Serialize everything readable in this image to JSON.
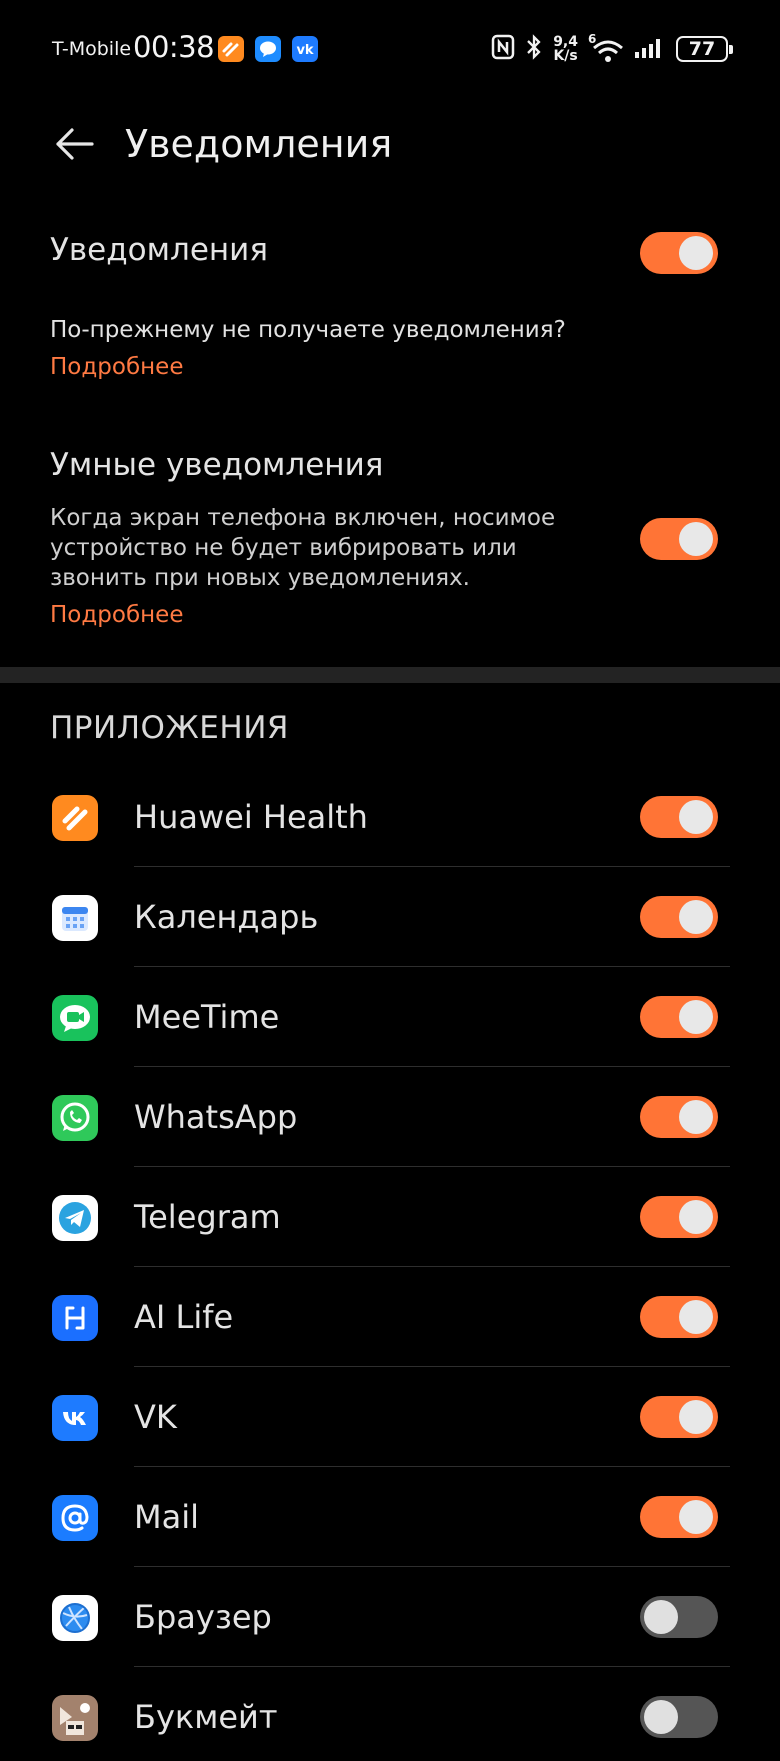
{
  "status_bar": {
    "carrier": "T-Mobile",
    "time": "00:38",
    "net_speed_value": "9,4",
    "net_speed_unit": "K/s",
    "wifi_label": "6",
    "battery": "77"
  },
  "header": {
    "title": "Уведомления"
  },
  "notifications": {
    "label": "Уведомления",
    "enabled": true,
    "hint": "По-прежнему не получаете уведомления?",
    "link": "Подробнее"
  },
  "smart": {
    "label": "Умные уведомления",
    "description": "Когда экран телефона включен, носимое устройство не будет вибрировать или звонить при новых уведомлениях.",
    "link": "Подробнее",
    "enabled": true
  },
  "apps_section": {
    "title": "ПРИЛОЖЕНИЯ",
    "items": [
      {
        "name": "Huawei Health",
        "icon": "huawei-health-icon",
        "enabled": true
      },
      {
        "name": "Календарь",
        "icon": "calendar-icon",
        "enabled": true
      },
      {
        "name": "MeeTime",
        "icon": "meetime-icon",
        "enabled": true
      },
      {
        "name": "WhatsApp",
        "icon": "whatsapp-icon",
        "enabled": true
      },
      {
        "name": "Telegram",
        "icon": "telegram-icon",
        "enabled": true
      },
      {
        "name": "AI Life",
        "icon": "ai-life-icon",
        "enabled": true
      },
      {
        "name": "VK",
        "icon": "vk-icon",
        "enabled": true
      },
      {
        "name": "Mail",
        "icon": "mail-icon",
        "enabled": true
      },
      {
        "name": "Браузер",
        "icon": "browser-icon",
        "enabled": false
      },
      {
        "name": "Букмейт",
        "icon": "bookmate-icon",
        "enabled": false
      }
    ]
  },
  "colors": {
    "accent": "#ff7436",
    "link": "#ff7a43",
    "background": "#000000"
  }
}
